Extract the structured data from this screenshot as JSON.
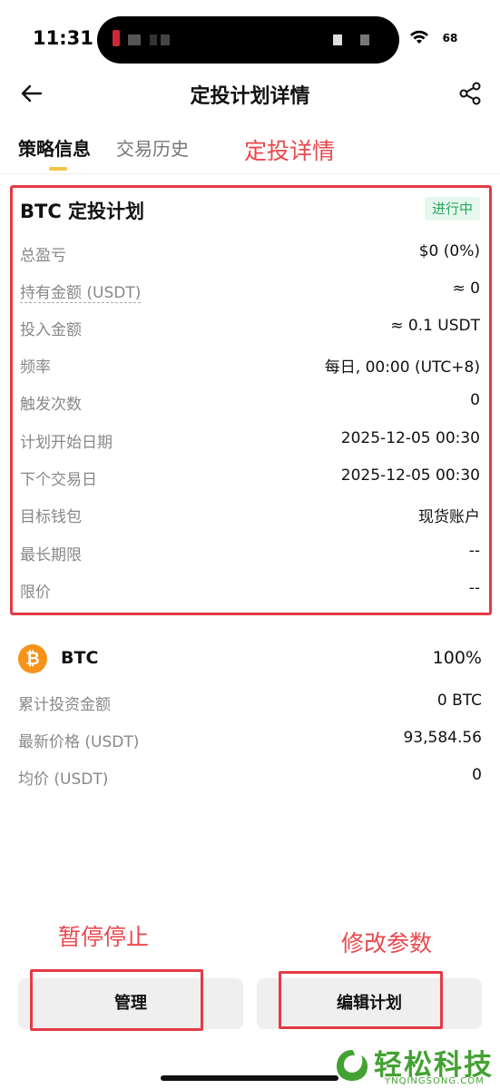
{
  "status_bar": {
    "time": "11:31",
    "battery": "68"
  },
  "header": {
    "title": "定投计划详情"
  },
  "tabs": [
    {
      "label": "策略信息",
      "active": true
    },
    {
      "label": "交易历史",
      "active": false
    }
  ],
  "annotations": {
    "detail": "定投详情",
    "pause_stop": "暂停停止",
    "modify_params": "修改参数"
  },
  "plan": {
    "title": "BTC 定投计划",
    "status": "进行中",
    "rows": [
      {
        "label": "总盈亏",
        "value": "$0 (0%)"
      },
      {
        "label": "持有金额 (USDT)",
        "value": "≈ 0"
      },
      {
        "label": "投入金额",
        "value": "≈ 0.1 USDT"
      },
      {
        "label": "频率",
        "value": "每日, 00:00 (UTC+8)"
      },
      {
        "label": "触发次数",
        "value": "0"
      },
      {
        "label": "计划开始日期",
        "value": "2025-12-05 00:30"
      },
      {
        "label": "下个交易日",
        "value": "2025-12-05 00:30"
      },
      {
        "label": "目标钱包",
        "value": "现货账户"
      },
      {
        "label": "最长期限",
        "value": "--"
      },
      {
        "label": "限价",
        "value": "--"
      }
    ]
  },
  "asset": {
    "icon": "₿",
    "name": "BTC",
    "percent": "100%",
    "rows": [
      {
        "label": "累计投资金额",
        "value": "0 BTC"
      },
      {
        "label": "最新价格 (USDT)",
        "value": "93,584.56"
      },
      {
        "label": "均价 (USDT)",
        "value": "0"
      }
    ]
  },
  "buttons": {
    "manage": "管理",
    "edit": "编辑计划"
  },
  "watermark": {
    "text": "轻松科技",
    "sub": "YNQINGSONG.COM"
  },
  "colors": {
    "accent": "#f6c34a",
    "annotation": "#e43b45",
    "status_green": "#25a75b",
    "btc": "#f7931a"
  }
}
